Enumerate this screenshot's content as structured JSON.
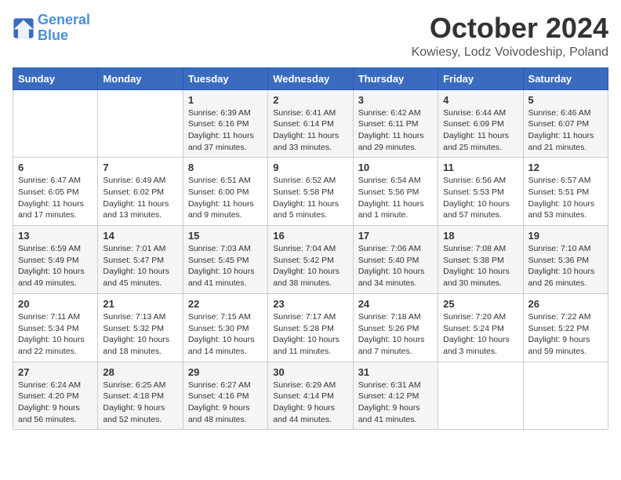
{
  "header": {
    "logo_line1": "General",
    "logo_line2": "Blue",
    "month": "October 2024",
    "location": "Kowiesy, Lodz Voivodeship, Poland"
  },
  "days_of_week": [
    "Sunday",
    "Monday",
    "Tuesday",
    "Wednesday",
    "Thursday",
    "Friday",
    "Saturday"
  ],
  "weeks": [
    [
      {
        "day": null,
        "info": null
      },
      {
        "day": null,
        "info": null
      },
      {
        "day": "1",
        "info": "Sunrise: 6:39 AM\nSunset: 6:16 PM\nDaylight: 11 hours and 37 minutes."
      },
      {
        "day": "2",
        "info": "Sunrise: 6:41 AM\nSunset: 6:14 PM\nDaylight: 11 hours and 33 minutes."
      },
      {
        "day": "3",
        "info": "Sunrise: 6:42 AM\nSunset: 6:11 PM\nDaylight: 11 hours and 29 minutes."
      },
      {
        "day": "4",
        "info": "Sunrise: 6:44 AM\nSunset: 6:09 PM\nDaylight: 11 hours and 25 minutes."
      },
      {
        "day": "5",
        "info": "Sunrise: 6:46 AM\nSunset: 6:07 PM\nDaylight: 11 hours and 21 minutes."
      }
    ],
    [
      {
        "day": "6",
        "info": "Sunrise: 6:47 AM\nSunset: 6:05 PM\nDaylight: 11 hours and 17 minutes."
      },
      {
        "day": "7",
        "info": "Sunrise: 6:49 AM\nSunset: 6:02 PM\nDaylight: 11 hours and 13 minutes."
      },
      {
        "day": "8",
        "info": "Sunrise: 6:51 AM\nSunset: 6:00 PM\nDaylight: 11 hours and 9 minutes."
      },
      {
        "day": "9",
        "info": "Sunrise: 6:52 AM\nSunset: 5:58 PM\nDaylight: 11 hours and 5 minutes."
      },
      {
        "day": "10",
        "info": "Sunrise: 6:54 AM\nSunset: 5:56 PM\nDaylight: 11 hours and 1 minute."
      },
      {
        "day": "11",
        "info": "Sunrise: 6:56 AM\nSunset: 5:53 PM\nDaylight: 10 hours and 57 minutes."
      },
      {
        "day": "12",
        "info": "Sunrise: 6:57 AM\nSunset: 5:51 PM\nDaylight: 10 hours and 53 minutes."
      }
    ],
    [
      {
        "day": "13",
        "info": "Sunrise: 6:59 AM\nSunset: 5:49 PM\nDaylight: 10 hours and 49 minutes."
      },
      {
        "day": "14",
        "info": "Sunrise: 7:01 AM\nSunset: 5:47 PM\nDaylight: 10 hours and 45 minutes."
      },
      {
        "day": "15",
        "info": "Sunrise: 7:03 AM\nSunset: 5:45 PM\nDaylight: 10 hours and 41 minutes."
      },
      {
        "day": "16",
        "info": "Sunrise: 7:04 AM\nSunset: 5:42 PM\nDaylight: 10 hours and 38 minutes."
      },
      {
        "day": "17",
        "info": "Sunrise: 7:06 AM\nSunset: 5:40 PM\nDaylight: 10 hours and 34 minutes."
      },
      {
        "day": "18",
        "info": "Sunrise: 7:08 AM\nSunset: 5:38 PM\nDaylight: 10 hours and 30 minutes."
      },
      {
        "day": "19",
        "info": "Sunrise: 7:10 AM\nSunset: 5:36 PM\nDaylight: 10 hours and 26 minutes."
      }
    ],
    [
      {
        "day": "20",
        "info": "Sunrise: 7:11 AM\nSunset: 5:34 PM\nDaylight: 10 hours and 22 minutes."
      },
      {
        "day": "21",
        "info": "Sunrise: 7:13 AM\nSunset: 5:32 PM\nDaylight: 10 hours and 18 minutes."
      },
      {
        "day": "22",
        "info": "Sunrise: 7:15 AM\nSunset: 5:30 PM\nDaylight: 10 hours and 14 minutes."
      },
      {
        "day": "23",
        "info": "Sunrise: 7:17 AM\nSunset: 5:28 PM\nDaylight: 10 hours and 11 minutes."
      },
      {
        "day": "24",
        "info": "Sunrise: 7:18 AM\nSunset: 5:26 PM\nDaylight: 10 hours and 7 minutes."
      },
      {
        "day": "25",
        "info": "Sunrise: 7:20 AM\nSunset: 5:24 PM\nDaylight: 10 hours and 3 minutes."
      },
      {
        "day": "26",
        "info": "Sunrise: 7:22 AM\nSunset: 5:22 PM\nDaylight: 9 hours and 59 minutes."
      }
    ],
    [
      {
        "day": "27",
        "info": "Sunrise: 6:24 AM\nSunset: 4:20 PM\nDaylight: 9 hours and 56 minutes."
      },
      {
        "day": "28",
        "info": "Sunrise: 6:25 AM\nSunset: 4:18 PM\nDaylight: 9 hours and 52 minutes."
      },
      {
        "day": "29",
        "info": "Sunrise: 6:27 AM\nSunset: 4:16 PM\nDaylight: 9 hours and 48 minutes."
      },
      {
        "day": "30",
        "info": "Sunrise: 6:29 AM\nSunset: 4:14 PM\nDaylight: 9 hours and 44 minutes."
      },
      {
        "day": "31",
        "info": "Sunrise: 6:31 AM\nSunset: 4:12 PM\nDaylight: 9 hours and 41 minutes."
      },
      {
        "day": null,
        "info": null
      },
      {
        "day": null,
        "info": null
      }
    ]
  ]
}
